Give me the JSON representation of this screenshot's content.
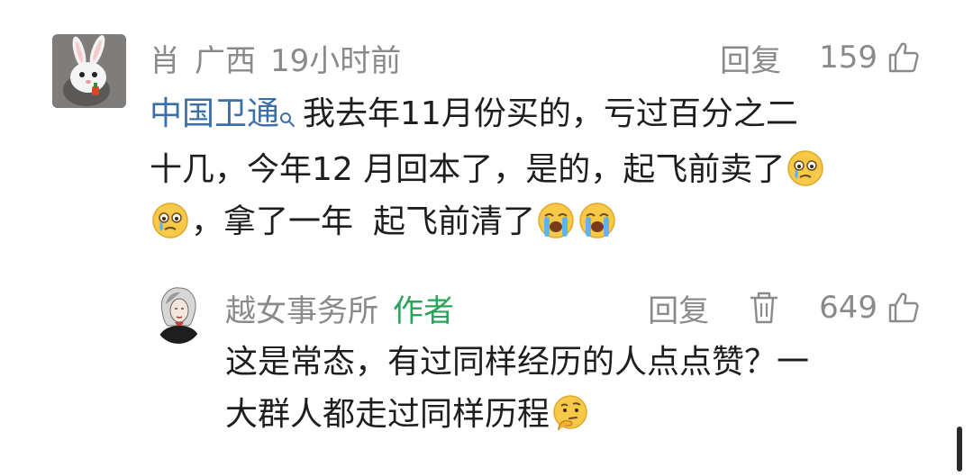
{
  "comment": {
    "user_name": "肖",
    "location": "广西",
    "time": "19小时前",
    "reply_label": "回复",
    "like_count": "159",
    "mention": "中国卫通",
    "line1": "我去年11月份买的，亏过百分之二",
    "line2": "十几，今年12 月回本了，是的，起飞前卖了",
    "line3a": "，拿了一年",
    "line3b": "起飞前清了"
  },
  "reply": {
    "user_name": "越女事务所",
    "author_tag": "作者",
    "reply_label": "回复",
    "like_count": "649",
    "line1": "这是常态，有过同样经历的人点点赞？一",
    "line2": "大群人都走过同样历程"
  },
  "colors": {
    "meta_gray": "#8a8a8a",
    "author_green": "#2aa45a",
    "mention_blue": "#3c6fa8"
  },
  "icons": {
    "like": "thumbs-up-icon",
    "delete": "trash-icon",
    "search": "search-icon",
    "crying": "crying-face-emoji",
    "loud_crying": "loudly-crying-face-emoji",
    "thinking": "thinking-face-emoji"
  }
}
